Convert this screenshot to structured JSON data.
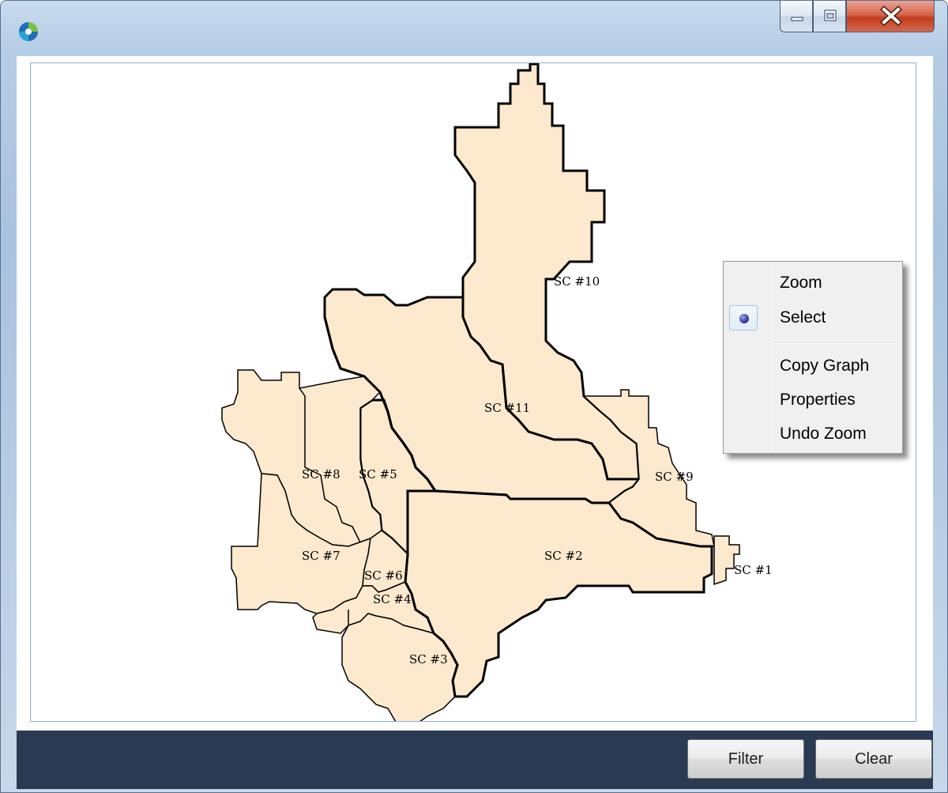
{
  "window": {
    "app_icon": "app-logo-icon",
    "controls": {
      "minimize_icon": "minimize-icon",
      "maximize_icon": "maximize-icon",
      "close_icon": "close-icon"
    }
  },
  "map": {
    "region_fill": "#fde9cd",
    "outline_color": "#000000",
    "labels": {
      "sc1": "SC #1",
      "sc2": "SC #2",
      "sc3": "SC #3",
      "sc4": "SC #4",
      "sc5": "SC #5",
      "sc6": "SC #6",
      "sc7": "SC #7",
      "sc8": "SC #8",
      "sc9": "SC #9",
      "sc10": "SC #10",
      "sc11": "SC #11"
    }
  },
  "context_menu": {
    "items": [
      {
        "label": "Zoom",
        "checked": false
      },
      {
        "label": "Select",
        "checked": true
      },
      {
        "label": "Copy Graph"
      },
      {
        "label": "Properties"
      },
      {
        "label": "Undo Zoom"
      }
    ]
  },
  "footer": {
    "filter_label": "Filter",
    "clear_label": "Clear",
    "background": "#2a3a52"
  }
}
